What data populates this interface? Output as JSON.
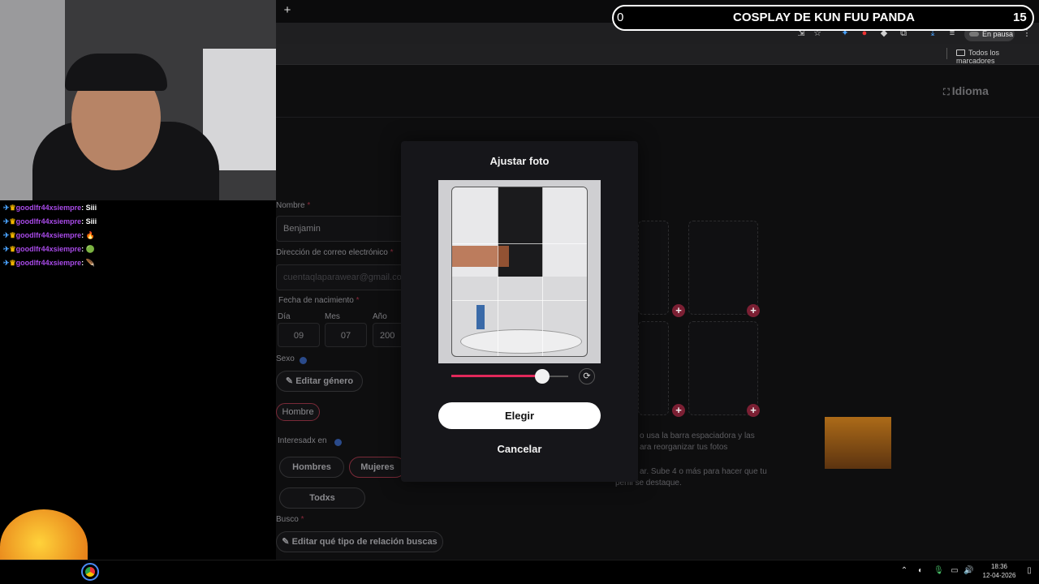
{
  "stream": {
    "banner_left": "0",
    "banner_title": "COSPLAY DE KUN FUU PANDA",
    "banner_right": "15"
  },
  "chat": {
    "lines": [
      {
        "user": "goodlfr44xsiempre",
        "msg": "Siii"
      },
      {
        "user": "goodlfr44xsiempre",
        "msg": "Siii"
      },
      {
        "user": "goodlfr44xsiempre",
        "msg": "🔥"
      },
      {
        "user": "goodlfr44xsiempre",
        "msg": "🟢"
      },
      {
        "user": "goodlfr44xsiempre",
        "msg": "🪶"
      }
    ],
    "user_color": "#a84ae8"
  },
  "browser": {
    "new_tab": "+",
    "paused_label": "En pausa",
    "bookmarks_all": "Todos los marcadores"
  },
  "page": {
    "language_link": "Idioma",
    "name_label": "Nombre",
    "name_value": "Benjamin",
    "email_label": "Dirección de correo electrónico",
    "email_value": "cuentaqlaparawear@gmail.co",
    "birth_label": "Fecha de nacimiento",
    "day_label": "Día",
    "day_value": "09",
    "month_label": "Mes",
    "month_value": "07",
    "year_label": "Año",
    "year_value": "200",
    "sex_label": "Sexo",
    "edit_gender": "Editar género",
    "gender_value": "Hombre",
    "interested_label": "Interesadx en",
    "interest_options": [
      "Hombres",
      "Mujeres",
      "Todxs"
    ],
    "interest_selected": "Mujeres",
    "seeking_label": "Busco",
    "edit_seeking": "Editar qué tipo de relación buscas",
    "photos_hint_1a": "o usa la barra espaciadora y las",
    "photos_hint_1b": "ara reorganizar tus fotos",
    "photos_hint_2a": "ar. Sube 4 o más para hacer que tu",
    "photos_hint_2b": "perfil se destaque.",
    "add_symbol": "+",
    "required_mark": "*"
  },
  "modal": {
    "title": "Ajustar foto",
    "zoom_level": 0.78,
    "choose_label": "Elegir",
    "cancel_label": "Cancelar",
    "accent": "#e0285a"
  },
  "taskbar": {
    "time": "18:36",
    "date": "12-04-2026"
  }
}
